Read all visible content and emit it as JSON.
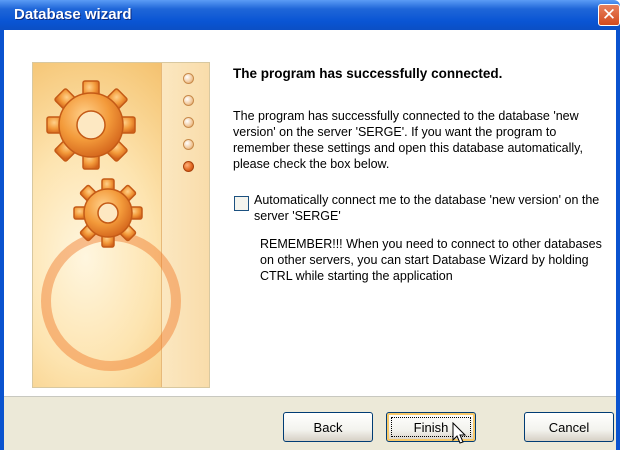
{
  "window": {
    "title": "Database wizard",
    "close_glyph": "✕"
  },
  "illustration": {
    "description_icon": "gears-icon",
    "step_indicators": [
      {
        "state": "inactive"
      },
      {
        "state": "inactive"
      },
      {
        "state": "inactive"
      },
      {
        "state": "inactive"
      },
      {
        "state": "active"
      }
    ]
  },
  "content": {
    "heading": "The program has successfully connected.",
    "paragraph": "The program has successfully connected to the database 'new version' on the server 'SERGE'. If you want the program to remember these settings and open this database automatically, please check the box below.",
    "auto_connect_label": "Automatically connect me to the database 'new version' on the server 'SERGE'",
    "auto_connect_checked": false,
    "remember_note": "REMEMBER!!! When you need to connect to other databases on other servers, you can start Database Wizard by holding CTRL while starting the application"
  },
  "buttons": {
    "back": "Back",
    "finish": "Finish",
    "cancel": "Cancel"
  },
  "colors": {
    "titlebar": "#0a55d4",
    "accent_orange": "#e0651e",
    "dialog_bg": "#ece9d8"
  }
}
